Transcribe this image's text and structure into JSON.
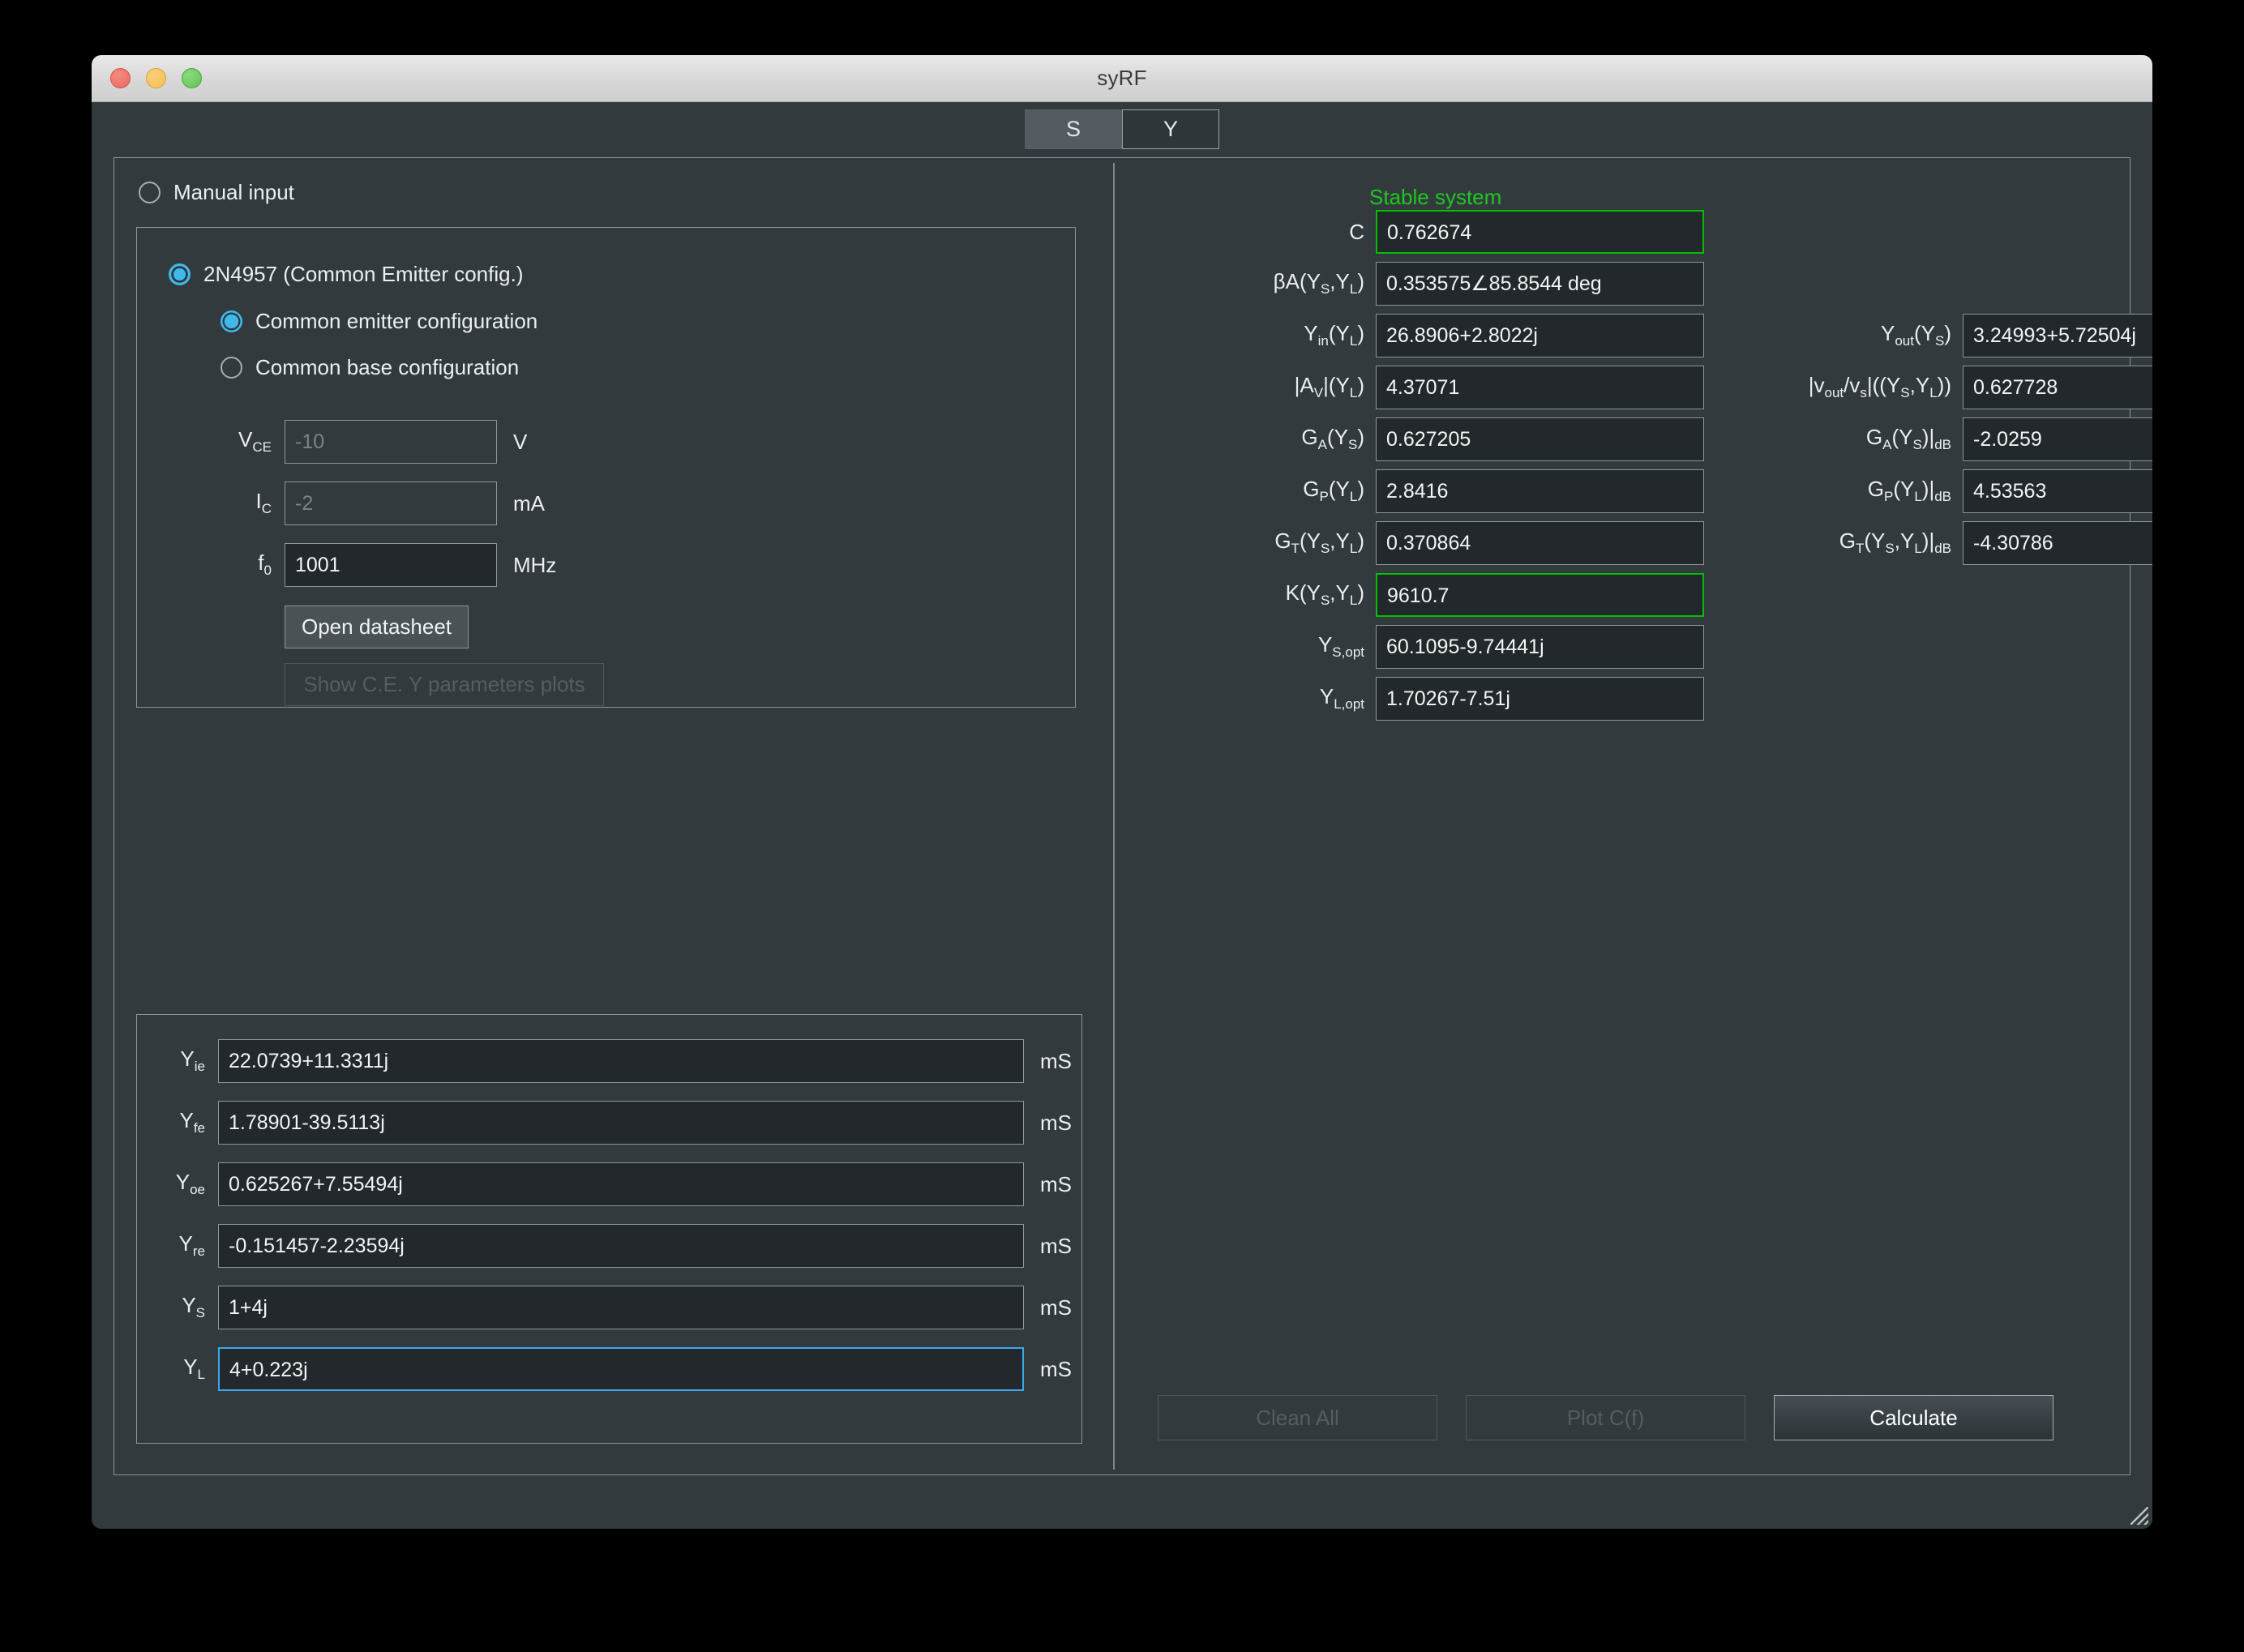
{
  "window": {
    "title": "syRF",
    "traffic_lights": [
      "close-red",
      "minimize-yellow",
      "maximize-green"
    ]
  },
  "tabs": [
    {
      "label": "S",
      "state": "hover"
    },
    {
      "label": "Y",
      "state": "active"
    }
  ],
  "left": {
    "manual_input": {
      "label": "Manual input",
      "selected": false
    },
    "device_group": {
      "device": {
        "label": "2N4957 (Common Emitter config.)",
        "selected": true
      },
      "config_options": [
        {
          "label": "Common emitter configuration",
          "selected": true
        },
        {
          "label": "Common base configuration",
          "selected": false
        }
      ],
      "bias": [
        {
          "label": "V",
          "sub": "CE",
          "value": "",
          "placeholder": "-10",
          "unit": "V"
        },
        {
          "label": "I",
          "sub": "C",
          "value": "",
          "placeholder": "-2",
          "unit": "mA"
        },
        {
          "label": "f",
          "sub": "0",
          "value": "1001",
          "placeholder": "",
          "unit": "MHz"
        }
      ],
      "open_datasheet_label": "Open datasheet",
      "show_plots_label": "Show C.E. Y parameters plots",
      "show_plots_disabled": true
    },
    "y_parameters": {
      "unit": "mS",
      "rows": [
        {
          "label": "Y",
          "sub": "ie",
          "value": "22.0739+11.3311j",
          "focus": false
        },
        {
          "label": "Y",
          "sub": "fe",
          "value": "1.78901-39.5113j",
          "focus": false
        },
        {
          "label": "Y",
          "sub": "oe",
          "value": "0.625267+7.55494j",
          "focus": false
        },
        {
          "label": "Y",
          "sub": "re",
          "value": "-0.151457-2.23594j",
          "focus": false
        },
        {
          "label": "Y",
          "sub": "S",
          "value": "1+4j",
          "focus": false
        },
        {
          "label": "Y",
          "sub": "L",
          "value": "4+0.223j",
          "focus": true
        }
      ]
    }
  },
  "right": {
    "status": {
      "text": "Stable system",
      "color": "#1ec81e"
    },
    "col1": [
      {
        "label_html": "C",
        "value": "0.762674",
        "highlight": "green"
      },
      {
        "label_html": "βA(Y<sub>S</sub>,Y<sub>L</sub>)",
        "value": "0.353575∠85.8544 deg",
        "highlight": "none"
      },
      {
        "label_html": "Y<sub>in</sub>(Y<sub>L</sub>)",
        "value": "26.8906+2.8022j",
        "highlight": "none"
      },
      {
        "label_html": "|A<sub>V</sub>|(Y<sub>L</sub>)",
        "value": "4.37071",
        "highlight": "none"
      },
      {
        "label_html": "G<sub>A</sub>(Y<sub>S</sub>)",
        "value": "0.627205",
        "highlight": "none"
      },
      {
        "label_html": "G<sub>P</sub>(Y<sub>L</sub>)",
        "value": "2.8416",
        "highlight": "none"
      },
      {
        "label_html": "G<sub>T</sub>(Y<sub>S</sub>,Y<sub>L</sub>)",
        "value": "0.370864",
        "highlight": "none"
      },
      {
        "label_html": "K(Y<sub>S</sub>,Y<sub>L</sub>)",
        "value": "9610.7",
        "highlight": "green"
      },
      {
        "label_html": "Y<sub>S,opt</sub>",
        "value": "60.1095-9.74441j",
        "highlight": "none"
      },
      {
        "label_html": "Y<sub>L,opt</sub>",
        "value": "1.70267-7.51j",
        "highlight": "none"
      }
    ],
    "col2": [
      {
        "label_html": "Y<sub>out</sub>(Y<sub>S</sub>)",
        "value": "3.24993+5.72504j",
        "highlight": "none"
      },
      {
        "label_html": "|v<sub>out</sub>/v<sub>s</sub>|((Y<sub>S</sub>,Y<sub>L</sub>))",
        "value": "0.627728",
        "highlight": "none"
      },
      {
        "label_html": "G<sub>A</sub>(Y<sub>S</sub>)|<sub>dB</sub>",
        "value": "-2.0259",
        "highlight": "none"
      },
      {
        "label_html": "G<sub>P</sub>(Y<sub>L</sub>)|<sub>dB</sub>",
        "value": "4.53563",
        "highlight": "none"
      },
      {
        "label_html": "G<sub>T</sub>(Y<sub>S</sub>,Y<sub>L</sub>)|<sub>dB</sub>",
        "value": "-4.30786",
        "highlight": "none"
      }
    ],
    "actions": [
      {
        "label": "Clean All",
        "disabled": true
      },
      {
        "label": "Plot C(f)",
        "disabled": true
      },
      {
        "label": "Calculate",
        "disabled": false
      }
    ]
  },
  "colors": {
    "window_bg": "#323a3e",
    "input_bg": "#22282b",
    "border": "#8e969b",
    "accent_blue": "#38a9e8",
    "accent_green": "#06bd06",
    "status_green": "#1ec81e"
  }
}
